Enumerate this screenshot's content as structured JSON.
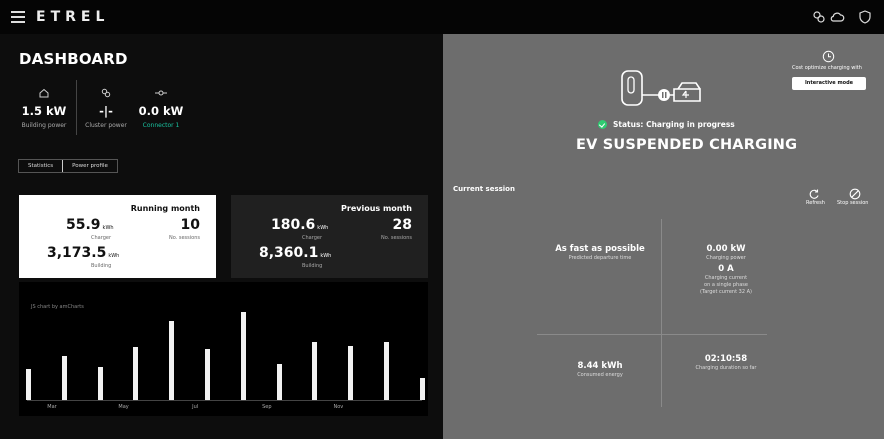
{
  "app": {
    "logo": "ETREL"
  },
  "dashboard": {
    "title": "DASHBOARD",
    "kpis": [
      {
        "icon": "house-icon",
        "value": "1.5 kW",
        "label": "Building power"
      },
      {
        "icon": "cluster-icon",
        "value": "-|-",
        "label": "Cluster power"
      },
      {
        "icon": "connector-icon",
        "value": "0.0 kW",
        "label": "Connector 1"
      }
    ],
    "tabs": {
      "active": "Statistics",
      "other": "Power profile"
    },
    "running_month": {
      "title": "Running month",
      "charger_value": "55.9",
      "charger_unit": "kWh",
      "charger_label": "Charger",
      "sessions_value": "10",
      "sessions_label": "No. sessions",
      "building_value": "3,173.5",
      "building_unit": "kWh",
      "building_label": "Building"
    },
    "previous_month": {
      "title": "Previous month",
      "charger_value": "180.6",
      "charger_unit": "kWh",
      "charger_label": "Charger",
      "sessions_value": "28",
      "sessions_label": "No. sessions",
      "building_value": "8,360.1",
      "building_unit": "kWh",
      "building_label": "Building"
    }
  },
  "chart_data": {
    "type": "bar",
    "credit": "JS chart by amCharts",
    "x_tick_labels": [
      "Mar",
      "May",
      "Jul",
      "Sep",
      "Nov"
    ],
    "values": [
      0.35,
      0.5,
      0.38,
      0.6,
      0.9,
      0.58,
      1.0,
      0.41,
      0.66,
      0.61,
      0.66,
      0.25
    ],
    "bar_color": "#f2f2f2"
  },
  "charger": {
    "status_prefix": "Status:",
    "status_text": "Charging in progress",
    "state": "EV SUSPENDED CHARGING",
    "cost_optimize_label": "Cost optimize charging with",
    "interactive_button": "Interactive mode",
    "session_title": "Current session",
    "refresh_label": "Refresh",
    "stop_label": "Stop session",
    "metrics": {
      "mode_value": "As fast as possible",
      "mode_label": "Predicted departure time",
      "power_value": "0.00 kW",
      "power_label": "Charging power",
      "current_value": "0 A",
      "current_label1": "Charging current",
      "current_label2": "on a single phase",
      "current_label3": "(Target current 32 A)",
      "energy_value": "8.44 kWh",
      "energy_label": "Consumed energy",
      "duration_value": "02:10:58",
      "duration_label": "Charging duration so far"
    },
    "status_color": "#2ecc71"
  }
}
